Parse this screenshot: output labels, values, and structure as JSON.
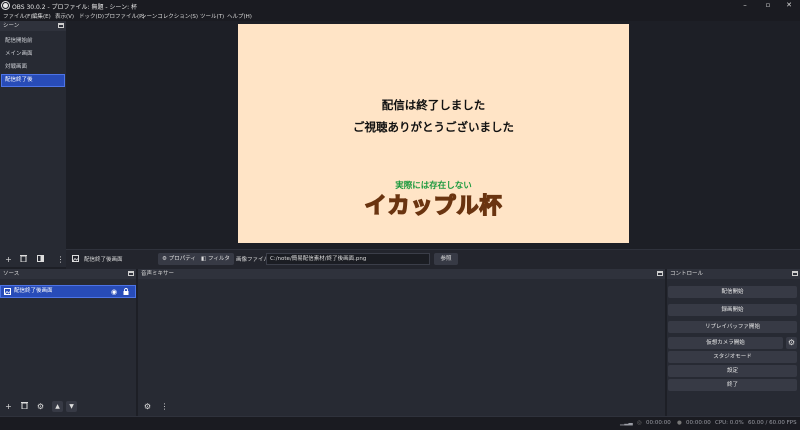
{
  "window": {
    "title": "OBS 30.0.2 - プロファイル: 無題 - シーン: 杯",
    "min_glyph": "–",
    "max_glyph": "▫",
    "close_glyph": "✕"
  },
  "menu": [
    "ファイル(F)",
    "編集(E)",
    "表示(V)",
    "ドック(D)",
    "プロファイル(P)",
    "シーンコレクション(S)",
    "ツール(T)",
    "ヘルプ(H)"
  ],
  "scenes": {
    "header": "シーン",
    "items": [
      "配信開始前",
      "メイン画面",
      "対戦画面",
      "配信終了後"
    ],
    "selected_index": 3
  },
  "canvas": {
    "line1": "配信は終了しました",
    "line2": "ご視聴ありがとうございました",
    "tagline": "実際には存在しない",
    "logo": "イカップル杯"
  },
  "source_toolbar": {
    "source_name": "配信終了後画面",
    "properties_label": "プロパティ",
    "filters_label": "フィルタ",
    "image_file_label": "画像ファイル",
    "image_path": "C:/note/簡易配信素材/終了後画面.png",
    "browse_label": "参照"
  },
  "sources": {
    "header": "ソース",
    "items": [
      "配信終了後画面"
    ]
  },
  "mixer": {
    "header": "音声ミキサー"
  },
  "controls": {
    "header": "コントロール",
    "start_streaming": "配信開始",
    "start_recording": "録画開始",
    "start_replay_buffer": "リプレイバッファ開始",
    "start_virtual_camera": "仮想カメラ開始",
    "studio_mode": "スタジオモード",
    "settings": "設定",
    "exit": "終了"
  },
  "status": {
    "stream_time": "00:00:00",
    "rec_time": "00:00:00",
    "cpu": "CPU: 0.0%",
    "fps": "60.00 / 60.00 FPS"
  },
  "colors": {
    "accent": "#284cb8",
    "canvas_bg": "#ffe4c6",
    "logo_orange": "#e0781d",
    "tagline_green": "#1d9a3f"
  }
}
